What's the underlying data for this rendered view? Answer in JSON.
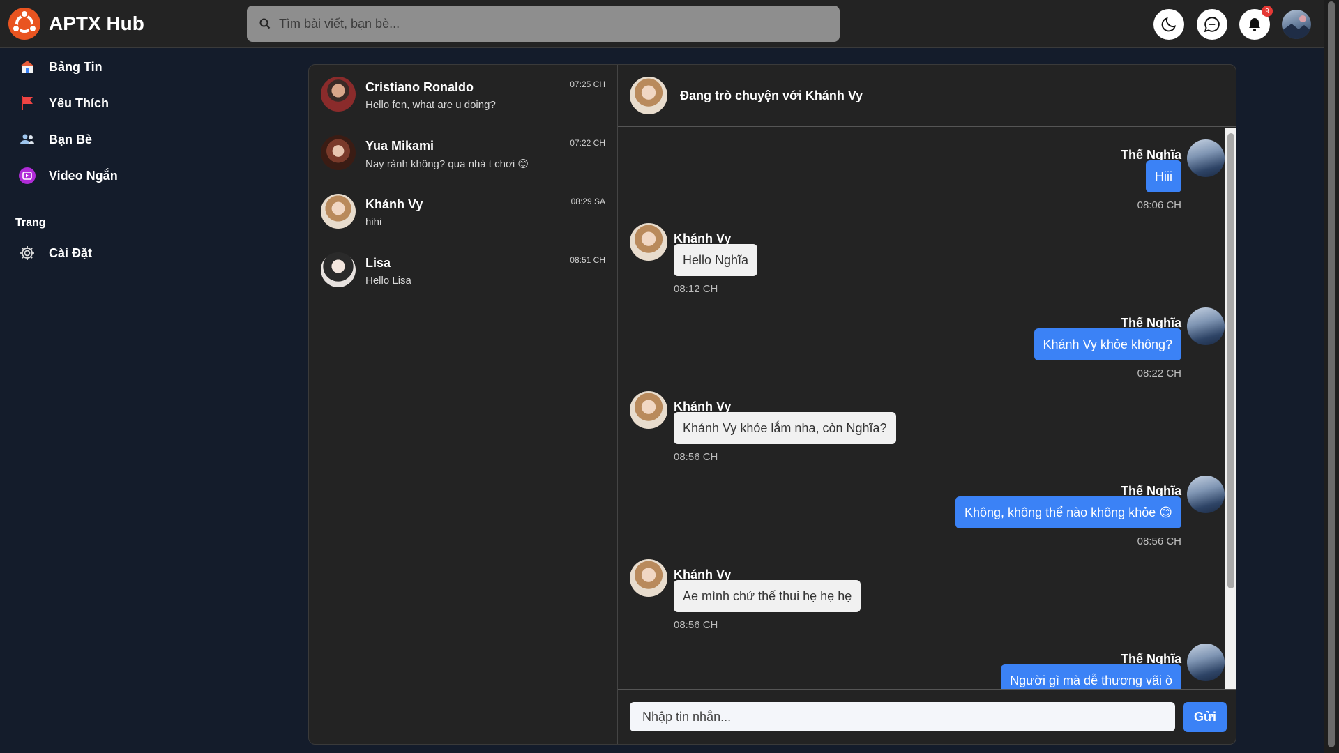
{
  "header": {
    "brand": "APTX Hub",
    "search_placeholder": "Tìm bài viết, bạn bè...",
    "notification_count": "9"
  },
  "sidebar": {
    "items": [
      {
        "label": "Bảng Tin",
        "icon": "home-icon"
      },
      {
        "label": "Yêu Thích",
        "icon": "flag-icon"
      },
      {
        "label": "Bạn Bè",
        "icon": "friends-icon"
      },
      {
        "label": "Video Ngắn",
        "icon": "video-icon"
      }
    ],
    "section_title": "Trang",
    "settings_label": "Cài Đặt"
  },
  "conversations": [
    {
      "name": "Cristiano Ronaldo",
      "preview": "Hello fen, what are u doing?",
      "time": "07:25 CH"
    },
    {
      "name": "Yua Mikami",
      "preview": "Nay rảnh không? qua nhà t chơi 😊",
      "time": "07:22 CH"
    },
    {
      "name": "Khánh Vy",
      "preview": "hihi",
      "time": "08:29 SA"
    },
    {
      "name": "Lisa",
      "preview": "Hello Lisa",
      "time": "08:51 CH"
    }
  ],
  "chat": {
    "header_title": "Đang trò chuyện với Khánh Vy",
    "messages": [
      {
        "sender": "Thế Nghĩa",
        "text": "Hiii",
        "time": "08:06 CH",
        "direction": "out"
      },
      {
        "sender": "Khánh Vy",
        "text": "Hello Nghĩa",
        "time": "08:12 CH",
        "direction": "in"
      },
      {
        "sender": "Thế Nghĩa",
        "text": "Khánh Vy khỏe không?",
        "time": "08:22 CH",
        "direction": "out"
      },
      {
        "sender": "Khánh Vy",
        "text": "Khánh Vy khỏe lắm nha, còn Nghĩa?",
        "time": "08:56 CH",
        "direction": "in"
      },
      {
        "sender": "Thế Nghĩa",
        "text": "Không, không thể nào không khỏe 😊",
        "time": "08:56 CH",
        "direction": "out"
      },
      {
        "sender": "Khánh Vy",
        "text": "Ae mình chứ thế thui hẹ hẹ hẹ",
        "time": "08:56 CH",
        "direction": "in"
      },
      {
        "sender": "Thế Nghĩa",
        "text": "Người gì mà dễ thương vãi ò",
        "time": "",
        "direction": "out"
      }
    ],
    "input_placeholder": "Nhập tin nhắn...",
    "send_label": "Gửi"
  },
  "colors": {
    "page_bg": "#141c2b",
    "panel_bg": "#232323",
    "accent_blue": "#3b82f6",
    "incoming_bubble": "#f1f1f1",
    "logo_orange": "#e95420",
    "badge_red": "#e53935"
  }
}
